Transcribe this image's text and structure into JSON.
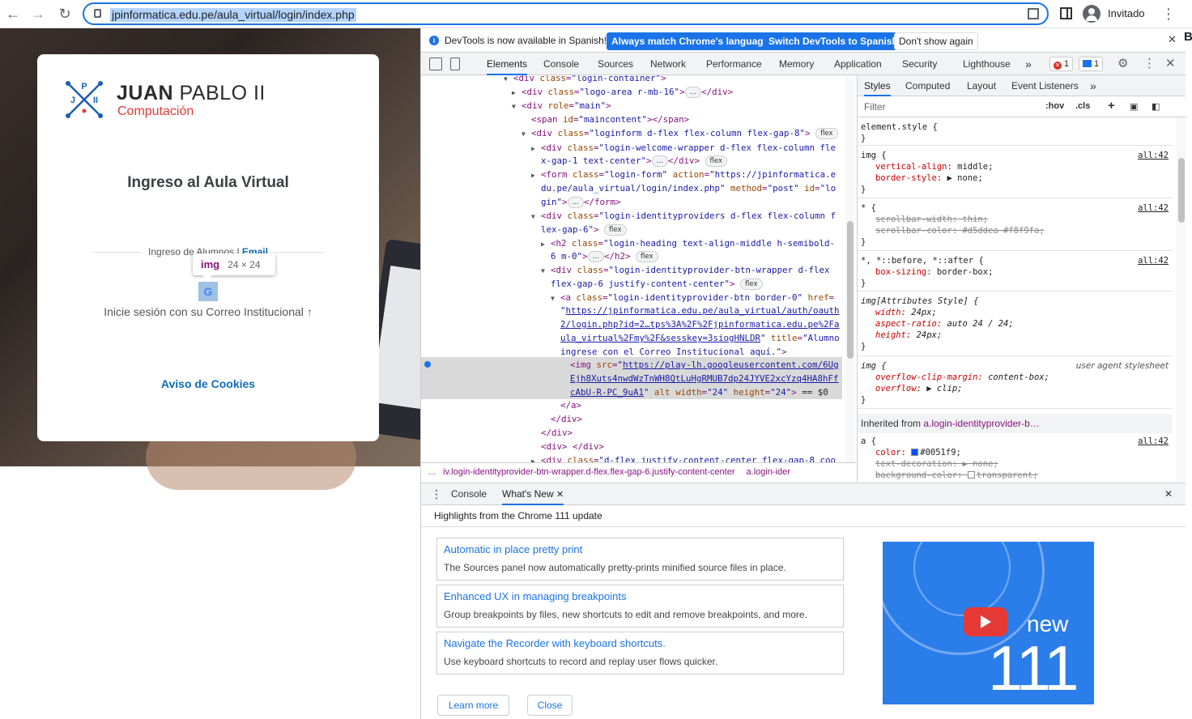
{
  "browser": {
    "url": "jpinformatica.edu.pe/aula_virtual/login/index.php",
    "profile_name": "Invitado",
    "icons": [
      "back-icon",
      "forward-icon",
      "reload-icon",
      "lock-icon",
      "qr-icon",
      "side-panel-icon",
      "profile-icon",
      "menu-icon"
    ]
  },
  "page": {
    "logo_bold": "JUAN",
    "logo_rest": " PABLO II",
    "logo_sub": "Computación",
    "logo_letters": [
      "J",
      "P",
      "II"
    ],
    "title": "Ingreso al Aula Virtual",
    "subheading": "Ingreso de Alumnos |",
    "subheading_link": " Email",
    "signin_text": "Inicie sesión con su Correo Institucional ↑",
    "cookies": "Aviso de Cookies",
    "tooltip_tag": "img",
    "tooltip_size": "24 × 24",
    "google_letter": "G"
  },
  "devtools": {
    "infobar": {
      "message": "DevTools is now available in Spanish!",
      "btn_match": "Always match Chrome's language",
      "btn_switch": "Switch DevTools to Spanish",
      "btn_dont": "Don't show again"
    },
    "tabs": [
      "Elements",
      "Console",
      "Sources",
      "Network",
      "Performance",
      "Memory",
      "Application",
      "Security",
      "Lighthouse"
    ],
    "more_tabs": "»",
    "error_count": "1",
    "message_count": "1",
    "styles_tabs": [
      "Styles",
      "Computed",
      "Layout",
      "Event Listeners"
    ],
    "filter_placeholder": "Filter",
    "hov": ":hov",
    "cls": ".cls",
    "crumb1": "iv.login-identityprovider-btn-wrapper.d-flex.flex-gap-6.justify-content-center",
    "crumb2": "a.login-ider",
    "inherited_label": "Inherited from ",
    "inherited_target": "a.login-identityprovider-b…",
    "drawer_tabs": [
      "Console",
      "What's New"
    ],
    "highlights": "Highlights from the Chrome 111 update",
    "features": [
      {
        "title": "Automatic in place pretty print",
        "desc": "The Sources panel now automatically pretty-prints minified source files in place."
      },
      {
        "title": "Enhanced UX in managing breakpoints",
        "desc": "Group breakpoints by files, new shortcuts to edit and remove breakpoints, and more."
      },
      {
        "title": "Navigate the Recorder with keyboard shortcuts.",
        "desc": "Use keyboard shortcuts to record and replay user flows quicker."
      }
    ],
    "learn_more": "Learn more",
    "close": "Close",
    "promo_new": "new",
    "promo_version": "111"
  },
  "colors": {
    "accent": "#1a73e8",
    "brand_red": "#e53935",
    "link": "#0f6cbf"
  }
}
